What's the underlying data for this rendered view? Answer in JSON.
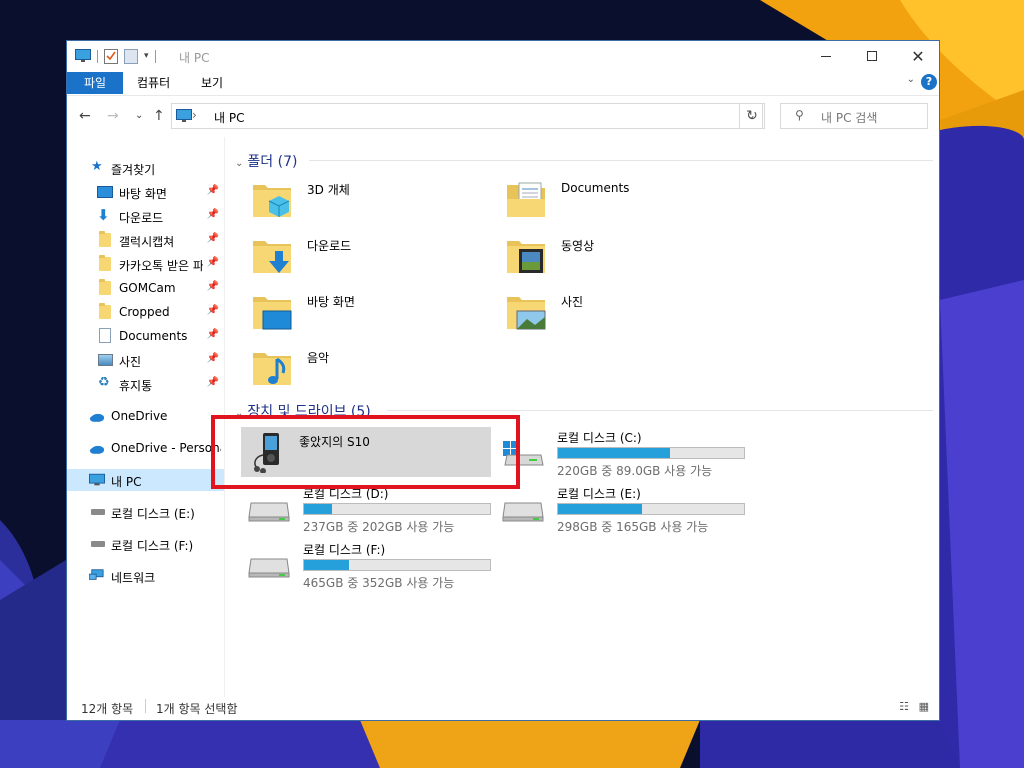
{
  "window": {
    "title": "내 PC"
  },
  "ribbon": {
    "tabs": [
      "파일",
      "컴퓨터",
      "보기"
    ]
  },
  "address": {
    "path": "내 PC",
    "search_placeholder": "내 PC 검색"
  },
  "sidebar": {
    "quick_access": "즐겨찾기",
    "items": [
      {
        "label": "바탕 화면",
        "icon": "desktop-icon",
        "pinned": true
      },
      {
        "label": "다운로드",
        "icon": "download-icon",
        "pinned": true
      },
      {
        "label": "갤럭시캡쳐",
        "icon": "folder-icon",
        "pinned": true
      },
      {
        "label": "카카오톡 받은 파",
        "icon": "folder-icon",
        "pinned": true
      },
      {
        "label": "GOMCam",
        "icon": "folder-icon",
        "pinned": true
      },
      {
        "label": "Cropped",
        "icon": "folder-icon",
        "pinned": true
      },
      {
        "label": "Documents",
        "icon": "documents-icon",
        "pinned": true
      },
      {
        "label": "사진",
        "icon": "pictures-icon",
        "pinned": true
      },
      {
        "label": "휴지통",
        "icon": "recycle-bin-icon",
        "pinned": true
      }
    ],
    "onedrive": "OneDrive",
    "onedrive_personal": "OneDrive - Personal",
    "this_pc": "내 PC",
    "drive_e": "로컬 디스크 (E:)",
    "drive_f": "로컬 디스크 (F:)",
    "network": "네트워크"
  },
  "folders": {
    "header": "폴더 (7)",
    "items": [
      "3D 개체",
      "Documents",
      "다운로드",
      "동영상",
      "바탕 화면",
      "사진",
      "음악"
    ]
  },
  "devices": {
    "header": "장치 및 드라이브 (5)",
    "phone": "좋았지의 S10",
    "drives": [
      {
        "name": "로컬 디스크 (C:)",
        "space": "220GB 중 89.0GB 사용 가능",
        "used": 0.6
      },
      {
        "name": "로컬 디스크 (D:)",
        "space": "237GB 중 202GB 사용 가능",
        "used": 0.15
      },
      {
        "name": "로컬 디스크 (E:)",
        "space": "298GB 중 165GB 사용 가능",
        "used": 0.45
      },
      {
        "name": "로컬 디스크 (F:)",
        "space": "465GB 중 352GB 사용 가능",
        "used": 0.24
      }
    ]
  },
  "status": {
    "count": "12개 항목",
    "selected": "1개 항목 선택함"
  },
  "colors": {
    "accent": "#1a73c9",
    "highlight": "#e0141e",
    "drive_fill": "#26a0da"
  }
}
